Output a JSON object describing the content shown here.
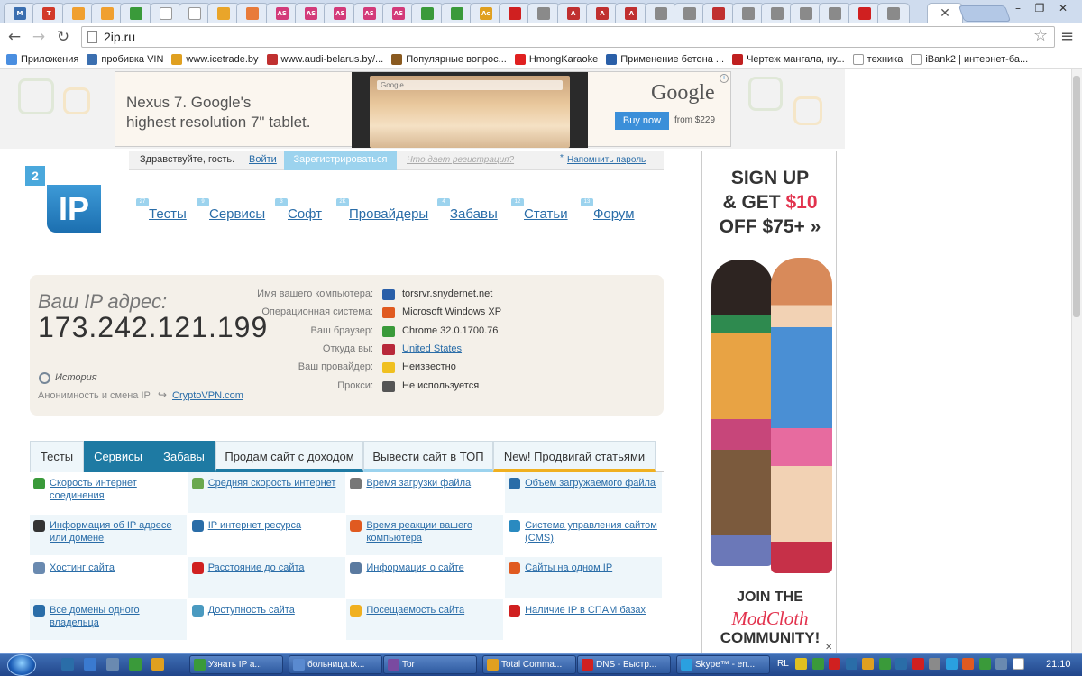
{
  "tabs": {
    "favicons": [
      {
        "text": "M",
        "color": "#3b6fb0"
      },
      {
        "text": "T",
        "color": "#d23a2a"
      },
      {
        "text": "",
        "color": "#f0a030"
      },
      {
        "text": "",
        "color": "#f0a030"
      },
      {
        "text": "",
        "color": "#3a9a3a"
      },
      {
        "text": "",
        "color": "#ffffff"
      },
      {
        "text": "",
        "color": "#ffffff"
      },
      {
        "text": "",
        "color": "#e9a52a"
      },
      {
        "text": "",
        "color": "#e87b3a"
      },
      {
        "text": "AS",
        "color": "#d33b7a"
      },
      {
        "text": "AS",
        "color": "#d33b7a"
      },
      {
        "text": "AS",
        "color": "#d33b7a"
      },
      {
        "text": "AS",
        "color": "#d33b7a"
      },
      {
        "text": "AS",
        "color": "#d33b7a"
      },
      {
        "text": "",
        "color": "#3a9a3a"
      },
      {
        "text": "",
        "color": "#3a9a3a"
      },
      {
        "text": "Ac",
        "color": "#e0a020"
      },
      {
        "text": "",
        "color": "#d02020"
      },
      {
        "text": "",
        "color": "#8a8a8a"
      },
      {
        "text": "A",
        "color": "#c03030"
      },
      {
        "text": "A",
        "color": "#c03030"
      },
      {
        "text": "A",
        "color": "#c03030"
      },
      {
        "text": "",
        "color": "#8a8a8a"
      },
      {
        "text": "",
        "color": "#8a8a8a"
      },
      {
        "text": "",
        "color": "#c03030"
      },
      {
        "text": "",
        "color": "#8a8a8a"
      },
      {
        "text": "",
        "color": "#8a8a8a"
      },
      {
        "text": "",
        "color": "#8a8a8a"
      },
      {
        "text": "",
        "color": "#8a8a8a"
      },
      {
        "text": "",
        "color": "#d02020"
      },
      {
        "text": "",
        "color": "#8a8a8a"
      }
    ],
    "close_glyph": "✕",
    "window_controls": [
      "–",
      "❐",
      "✕"
    ]
  },
  "omnibox": {
    "url": "2ip.ru"
  },
  "bookmarks": [
    {
      "label": "Приложения",
      "color": "#4a8ee0"
    },
    {
      "label": "пробивка VIN",
      "color": "#3b6fb0"
    },
    {
      "label": "www.icetrade.by",
      "color": "#e0a020"
    },
    {
      "label": "www.audi-belarus.by/...",
      "color": "#c03030"
    },
    {
      "label": "Популярные вопрос...",
      "color": "#8a5a20"
    },
    {
      "label": "HmongKaraoke",
      "color": "#e02020"
    },
    {
      "label": "Применение бетона ...",
      "color": "#2a5fa8"
    },
    {
      "label": "Чертеж мангала, ну...",
      "color": "#c02020"
    },
    {
      "label": "техника",
      "color": "#ffffff"
    },
    {
      "label": "iBank2 | интернет-ба...",
      "color": "#ffffff"
    }
  ],
  "ad_top": {
    "line1": "Nexus 7. Google's",
    "line2": "highest resolution 7\" tablet.",
    "search_text": "Google",
    "brand": "Google",
    "buy": "Buy now",
    "price": "from $229",
    "info": "i"
  },
  "greeting": {
    "hello": "Здравствуйте, гость.",
    "login": "Войти",
    "register": "Зарегистрироваться",
    "why": "Что дает регистрация?",
    "remind_star": "*",
    "remind": "Напомнить пароль"
  },
  "logo": {
    "small": "2",
    "big": "IP"
  },
  "nav": [
    {
      "label": "Тесты",
      "badge": "27"
    },
    {
      "label": "Сервисы",
      "badge": "9"
    },
    {
      "label": "Софт",
      "badge": "3"
    },
    {
      "label": "Провайдеры",
      "badge": "2K"
    },
    {
      "label": "Забавы",
      "badge": "4"
    },
    {
      "label": "Статьи",
      "badge": "12"
    },
    {
      "label": "Форум",
      "badge": "13"
    }
  ],
  "ipbox": {
    "label": "Ваш IP адрес:",
    "ip": "173.242.121.199",
    "history": "История",
    "anon": "Анонимность и смена IP",
    "crypto": "CryptoVPN.com",
    "rows": [
      {
        "label": "Имя вашего компьютера:",
        "value": "torsrvr.snydernet.net",
        "icon": "computer-icon",
        "color": "#2a5fa8"
      },
      {
        "label": "Операционная система:",
        "value": "Microsoft Windows XP",
        "icon": "windows-icon",
        "color": "#e05a20"
      },
      {
        "label": "Ваш браузер:",
        "value": "Chrome 32.0.1700.76",
        "icon": "chrome-icon",
        "color": "#3a9a3a"
      },
      {
        "label": "Откуда вы:",
        "value": "United States",
        "icon": "us-flag-icon",
        "color": "#b8283a"
      },
      {
        "label": "Ваш провайдер:",
        "value": "Неизвестно",
        "icon": "warning-icon",
        "color": "#f0c020"
      },
      {
        "label": "Прокси:",
        "value": "Не используется",
        "icon": "glasses-icon",
        "color": "#555555"
      }
    ]
  },
  "page_tabs": [
    "Тесты",
    "Сервисы",
    "Забавы",
    "Продам сайт с доходом",
    "Вывести сайт в ТОП",
    "New! Продвигай статьями"
  ],
  "grid": [
    {
      "text": "Скорость интернет соединения",
      "color": "#3a9a3a"
    },
    {
      "text": "Средняя скорость интернет",
      "color": "#6aa84f"
    },
    {
      "text": "Время загрузки файла",
      "color": "#777777"
    },
    {
      "text": "Объем загружаемого файла",
      "color": "#2a6da8"
    },
    {
      "text": "Информация об IP адресе или домене",
      "color": "#333333"
    },
    {
      "text": "IP интернет ресурса",
      "color": "#2a6da8"
    },
    {
      "text": "Время реакции вашего компьютера",
      "color": "#e05a20"
    },
    {
      "text": "Система управления сайтом (CMS)",
      "color": "#2a8ac0"
    },
    {
      "text": "Хостинг сайта",
      "color": "#6a8ab0"
    },
    {
      "text": "Расстояние до сайта",
      "color": "#d02020"
    },
    {
      "text": "Информация о сайте",
      "color": "#5a7aa0"
    },
    {
      "text": "Сайты на одном IP",
      "color": "#e05a20"
    },
    {
      "text": "Все домены одного владельца",
      "color": "#2a6da8"
    },
    {
      "text": "Доступность сайта",
      "color": "#4a9ac0"
    },
    {
      "text": "Посещаемость сайта",
      "color": "#f0b020"
    },
    {
      "text": "Наличие IP в СПАМ базах",
      "color": "#d02020"
    }
  ],
  "side_ad": {
    "l1": "SIGN UP",
    "l2a": "& GET ",
    "l2b": "$10",
    "l3": "OFF $75+ »",
    "join": "JOIN THE",
    "modcloth": "ModCloth",
    "community": "COMMUNITY!",
    "close": "✕"
  },
  "taskbar": {
    "quick": [
      "#2a6da8",
      "#3a7ad0",
      "#6a8ab0",
      "#3a9a3a",
      "#e0a020"
    ],
    "items": [
      {
        "label": "Узнать IP а...",
        "color": "#3a9a3a"
      },
      {
        "label": "больница.tx...",
        "color": "#5a8ad0"
      },
      {
        "label": "Tor",
        "color": "#7a4aa0"
      },
      {
        "label": "Total Comma...",
        "color": "#e0a020"
      },
      {
        "label": "DNS - Быстр...",
        "color": "#d02020"
      },
      {
        "label": "Skype™ - en...",
        "color": "#2aa0e0"
      }
    ],
    "lang": "RL",
    "tray": [
      "#e0c020",
      "#3a9a3a",
      "#d02020",
      "#2a6da8",
      "#e0a020",
      "#3a9a3a",
      "#2a6da8",
      "#d02020",
      "#8a8a8a",
      "#2aa0e0",
      "#e05a20",
      "#3a9a3a",
      "#6a8ab0",
      "#ffffff"
    ],
    "clock": "21:10"
  }
}
